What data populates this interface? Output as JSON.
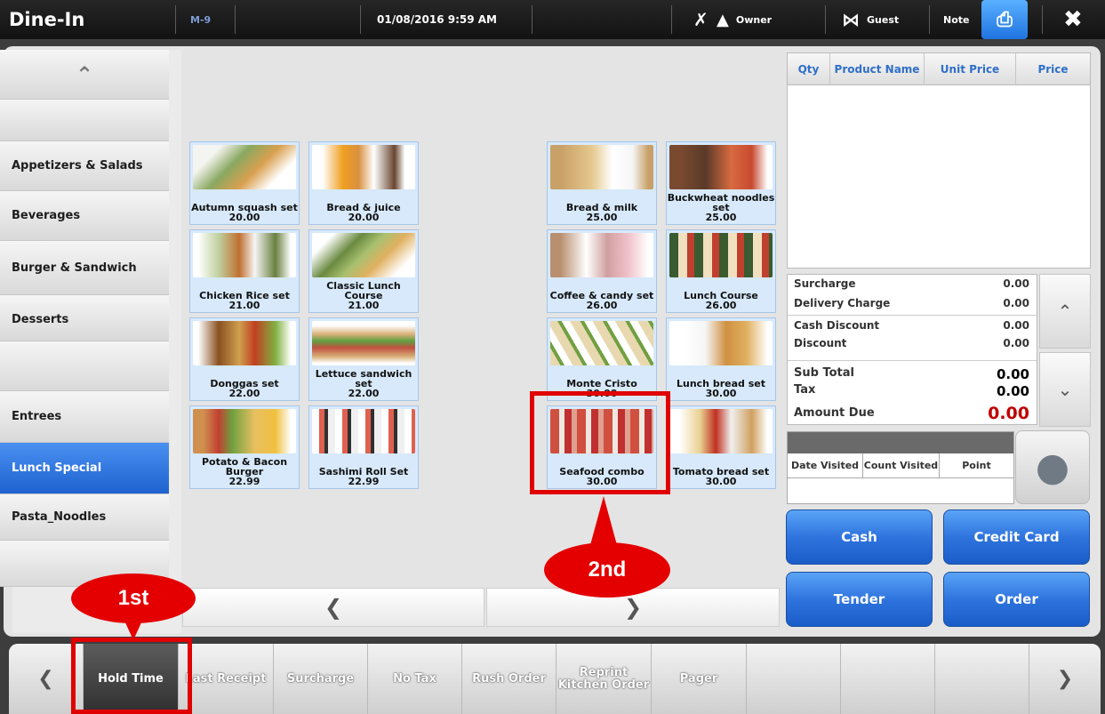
{
  "header": {
    "title": "Dine-In",
    "table_no": "M-9",
    "datetime": "01/08/2016  9:59 AM",
    "owner_label": "Owner",
    "guest_label": "Guest",
    "note_label": "Note",
    "icons": [
      "utensils-icon",
      "cloche-icon",
      "guest-icon",
      "printer-icon",
      "close-icon"
    ]
  },
  "categories": [
    "Appetizers & Salads",
    "Beverages",
    "Burger & Sandwich",
    "Desserts",
    "",
    "Entrees",
    "Lunch Special",
    "Pasta_Noodles",
    ""
  ],
  "active_category": "Lunch Special",
  "products": [
    {
      "name": "Autumn squash set",
      "price": "20.00"
    },
    {
      "name": "Bread & juice",
      "price": "20.00"
    },
    {
      "name": "Bread & milk",
      "price": "25.00"
    },
    {
      "name": "Buckwheat noodles set",
      "price": "25.00"
    },
    {
      "name": "Chicken Rice set",
      "price": "21.00"
    },
    {
      "name": "Classic Lunch Course",
      "price": "21.00"
    },
    {
      "name": "Coffee & candy set",
      "price": "26.00"
    },
    {
      "name": "Lunch Course",
      "price": "26.00"
    },
    {
      "name": "Donggas set",
      "price": "22.00"
    },
    {
      "name": "Lettuce sandwich set",
      "price": "22.00"
    },
    {
      "name": "Monte Cristo",
      "price": "30.00"
    },
    {
      "name": "Lunch bread set",
      "price": "30.00"
    },
    {
      "name": "Potato & Bacon Burger",
      "price": "22.99"
    },
    {
      "name": "Sashimi Roll Set",
      "price": "22.99"
    },
    {
      "name": "Seafood combo",
      "price": "30.00"
    },
    {
      "name": "Tomato bread set",
      "price": "30.00"
    }
  ],
  "order_table": {
    "headers": [
      "Qty",
      "Product Name",
      "Unit Price",
      "Price"
    ]
  },
  "totals": {
    "surcharge_label": "Surcharge",
    "surcharge": "0.00",
    "delivery_label": "Delivery Charge",
    "delivery": "0.00",
    "cash_discount_label": "Cash Discount",
    "cash_discount": "0.00",
    "discount_label": "Discount",
    "discount": "0.00",
    "subtotal_label": "Sub Total",
    "subtotal": "0.00",
    "tax_label": "Tax",
    "tax": "0.00",
    "amount_due_label": "Amount Due",
    "amount_due": "0.00"
  },
  "customer": {
    "headers": [
      "Date Visited",
      "Count Visited",
      "Point"
    ]
  },
  "pay_buttons": {
    "cash": "Cash",
    "credit": "Credit Card",
    "tender": "Tender",
    "order": "Order"
  },
  "toolbar": [
    "Hold Time",
    "Last Receipt",
    "Surcharge",
    "No Tax",
    "Rush Order",
    "Reprint Kitchen Order",
    "Pager",
    "",
    "",
    ""
  ],
  "annotations": {
    "first": "1st",
    "second": "2nd"
  },
  "colors": {
    "accent_blue": "#2f74de",
    "highlight_red": "#e00000",
    "amount_due_red": "#c00000"
  }
}
